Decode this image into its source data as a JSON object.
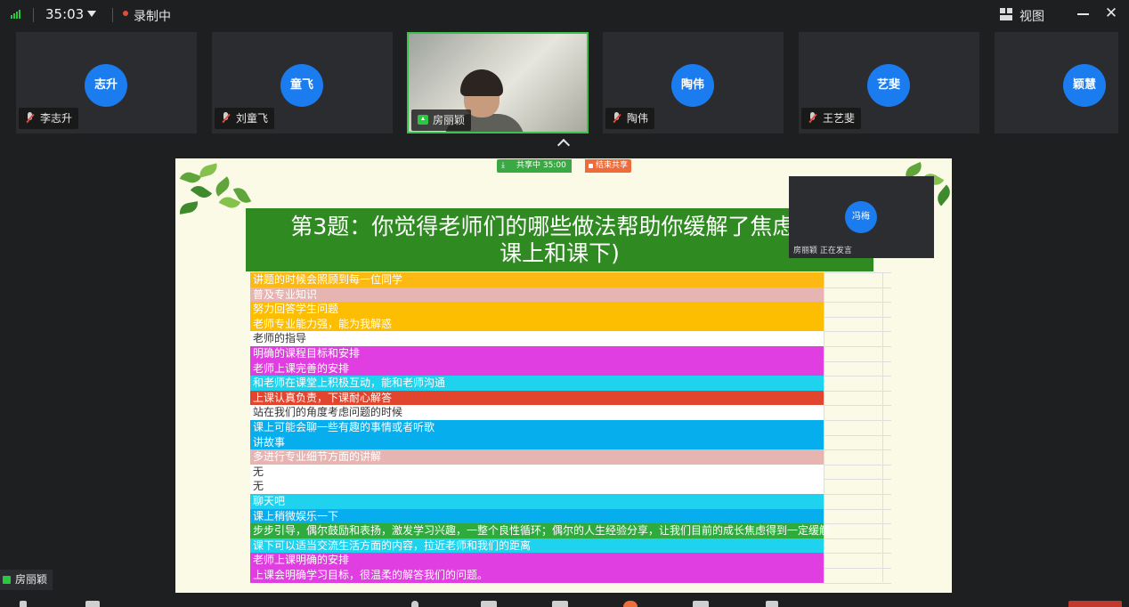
{
  "topbar": {
    "timer": "35:03",
    "recording_label": "录制中",
    "view_label": "视图"
  },
  "participants": [
    {
      "avatar": "志升",
      "name": "李志升",
      "has_video": false
    },
    {
      "avatar": "童飞",
      "name": "刘童飞",
      "has_video": false
    },
    {
      "avatar": "",
      "name": "房丽颖",
      "has_video": true
    },
    {
      "avatar": "陶伟",
      "name": "陶伟",
      "has_video": false
    },
    {
      "avatar": "艺斐",
      "name": "王艺斐",
      "has_video": false
    },
    {
      "avatar": "颖慧",
      "name": "",
      "has_video": false
    }
  ],
  "share_bar": {
    "status": "共享中 35:00",
    "stop": "结束共享"
  },
  "slide": {
    "title_line1": "第3题：你觉得老师们的哪些做法帮助你缓解了焦虑?（",
    "title_line2": "课上和课下)",
    "rows": [
      {
        "text": "讲题的时候会照顾到每一位同学",
        "color": "#fdb913",
        "dark": false
      },
      {
        "text": "普及专业知识",
        "color": "#e6b4b1",
        "dark": false
      },
      {
        "text": "努力回答学生问题",
        "color": "#fdbd00",
        "dark": false
      },
      {
        "text": "老师专业能力强，能为我解惑",
        "color": "#fdbd00",
        "dark": false
      },
      {
        "text": "老师的指导",
        "color": "#ffffff",
        "dark": true
      },
      {
        "text": "明确的课程目标和安排",
        "color": "#e03ee0",
        "dark": false
      },
      {
        "text": "老师上课完善的安排",
        "color": "#e03ee0",
        "dark": false
      },
      {
        "text": "和老师在课堂上积极互动，能和老师沟通",
        "color": "#1fd2ee",
        "dark": false
      },
      {
        "text": "上课认真负责，下课耐心解答",
        "color": "#e2452e",
        "dark": false
      },
      {
        "text": "站在我们的角度考虑问题的时候",
        "color": "#ffffff",
        "dark": true
      },
      {
        "text": "课上可能会聊一些有趣的事情或者听歌",
        "color": "#07aeed",
        "dark": false
      },
      {
        "text": "讲故事",
        "color": "#07aeed",
        "dark": false
      },
      {
        "text": "多进行专业细节方面的讲解",
        "color": "#e6b4b1",
        "dark": false
      },
      {
        "text": "无",
        "color": "#ffffff",
        "dark": true
      },
      {
        "text": "无",
        "color": "#ffffff",
        "dark": true
      },
      {
        "text": "聊天吧",
        "color": "#1fd2ee",
        "dark": false
      },
      {
        "text": "课上稍微娱乐一下",
        "color": "#07aeed",
        "dark": false
      },
      {
        "text": "步步引导，偶尔鼓励和表扬，激发学习兴趣，一整个良性循环；偶尔的人生经验分享，让我们目前的成长焦虑得到一定缓解",
        "color": "#2faa3d",
        "dark": false
      },
      {
        "text": "课下可以适当交流生活方面的内容，拉近老师和我们的距离",
        "color": "#1fd2ee",
        "dark": false
      },
      {
        "text": "老师上课明确的安排",
        "color": "#e03ee0",
        "dark": false
      },
      {
        "text": "上课会明确学习目标，很温柔的解答我们的问题。",
        "color": "#e03ee0",
        "dark": false
      }
    ]
  },
  "active_speaker": {
    "avatar": "冯梅",
    "label": "房丽颖 正在发言"
  },
  "self_view": {
    "name": "房丽颖"
  },
  "colors": {
    "accent_blue": "#1b7cf0",
    "accent_green": "#28c840",
    "recording_red": "#e24a3b"
  }
}
